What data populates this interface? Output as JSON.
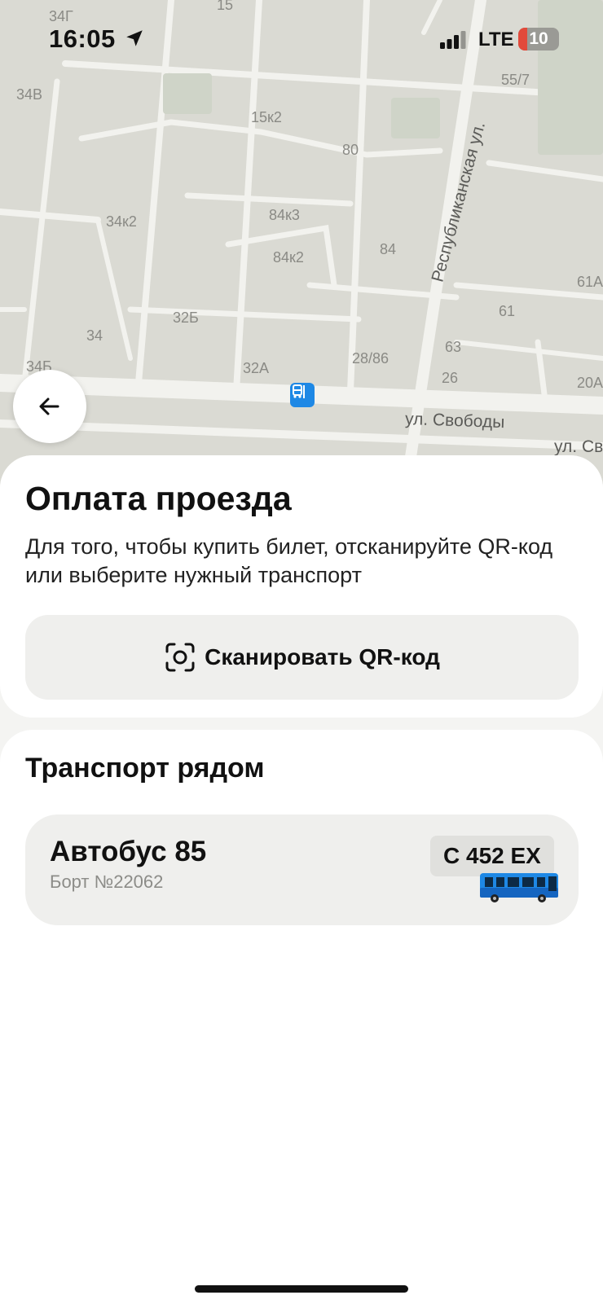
{
  "status_bar": {
    "time": "16:05",
    "network": "LTE",
    "battery_level": "10",
    "battery_fraction": 0.1,
    "location_icon": "location-arrow-icon",
    "signal_icon": "cellular-signal-icon"
  },
  "map": {
    "house_numbers": [
      "34Г",
      "15",
      "34В",
      "55/7",
      "15к2",
      "80",
      "34к2",
      "84к3",
      "84к2",
      "84",
      "61А",
      "32Б",
      "61",
      "34",
      "63",
      "34Б",
      "28/86",
      "32А",
      "26",
      "20А"
    ],
    "streets": {
      "republic": "Республиканская ул.",
      "svobody": "ул. Свободы",
      "svobody_cut": "ул. Св"
    },
    "stop_icon": "bus-stop-icon"
  },
  "back_button": {
    "icon": "arrow-left-icon"
  },
  "payment": {
    "title": "Оплата проезда",
    "description": "Для того, чтобы купить билет, отсканируйте QR-код или выберите нужный транспорт",
    "scan_button_label": "Сканировать QR-код",
    "scan_icon": "qr-scan-icon"
  },
  "nearby": {
    "title": "Транспорт рядом",
    "vehicles": [
      {
        "name": "Автобус 85",
        "board": "Борт №22062",
        "plate": "С 452 ЕХ",
        "icon": "bus-icon"
      }
    ]
  },
  "colors": {
    "map_background": "#dadad3",
    "map_road": "#f2f2ee",
    "accent_blue": "#1e88e5",
    "battery_red": "#e24a3b",
    "button_gray": "#efefed"
  }
}
